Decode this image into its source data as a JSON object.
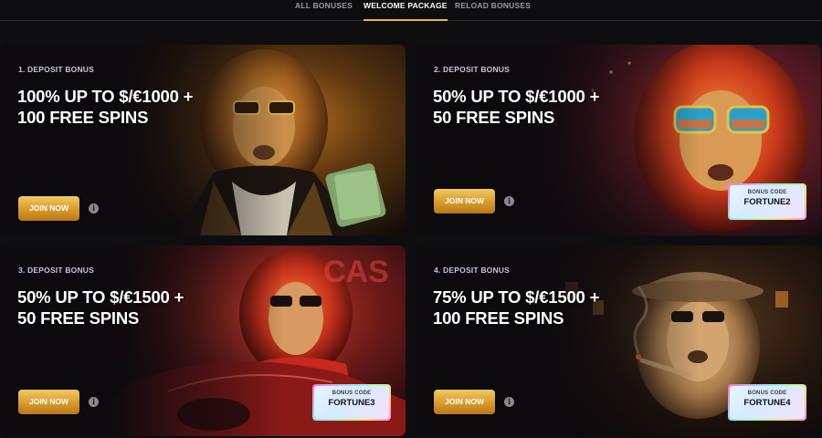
{
  "tabs": [
    {
      "label": "ALL BONUSES",
      "active": false
    },
    {
      "label": "WELCOME PACKAGE",
      "active": true
    },
    {
      "label": "RELOAD BONUSES",
      "active": false
    }
  ],
  "colors": {
    "accent_gold": "#e8b64a",
    "background": "#0e0e10"
  },
  "info_glyph": "i",
  "cards": [
    {
      "label": "1. DEPOSIT BONUS",
      "headline_line1": "100% UP TO $/€1000 +",
      "headline_line2": "100 FREE SPINS",
      "join_label": "JOIN NOW",
      "art_icon": "lion-in-suit-with-money-icon"
    },
    {
      "label": "2. DEPOSIT BONUS",
      "headline_line1": "50% UP TO $/€1000 +",
      "headline_line2": "50 FREE SPINS",
      "join_label": "JOIN NOW",
      "code_caption": "BONUS CODE",
      "code_value": "FORTUNE2",
      "art_icon": "lion-with-sunglasses-icon"
    },
    {
      "label": "3. DEPOSIT BONUS",
      "headline_line1": "50% UP TO $/€1500 +",
      "headline_line2": "50 FREE SPINS",
      "join_label": "JOIN NOW",
      "code_caption": "BONUS CODE",
      "code_value": "FORTUNE3",
      "art_icon": "lion-in-red-car-icon"
    },
    {
      "label": "4. DEPOSIT BONUS",
      "headline_line1": "75% UP TO $/€1500 +",
      "headline_line2": "100 FREE SPINS",
      "join_label": "JOIN NOW",
      "code_caption": "BONUS CODE",
      "code_value": "FORTUNE4",
      "art_icon": "lion-in-hat-with-cigar-icon"
    }
  ]
}
